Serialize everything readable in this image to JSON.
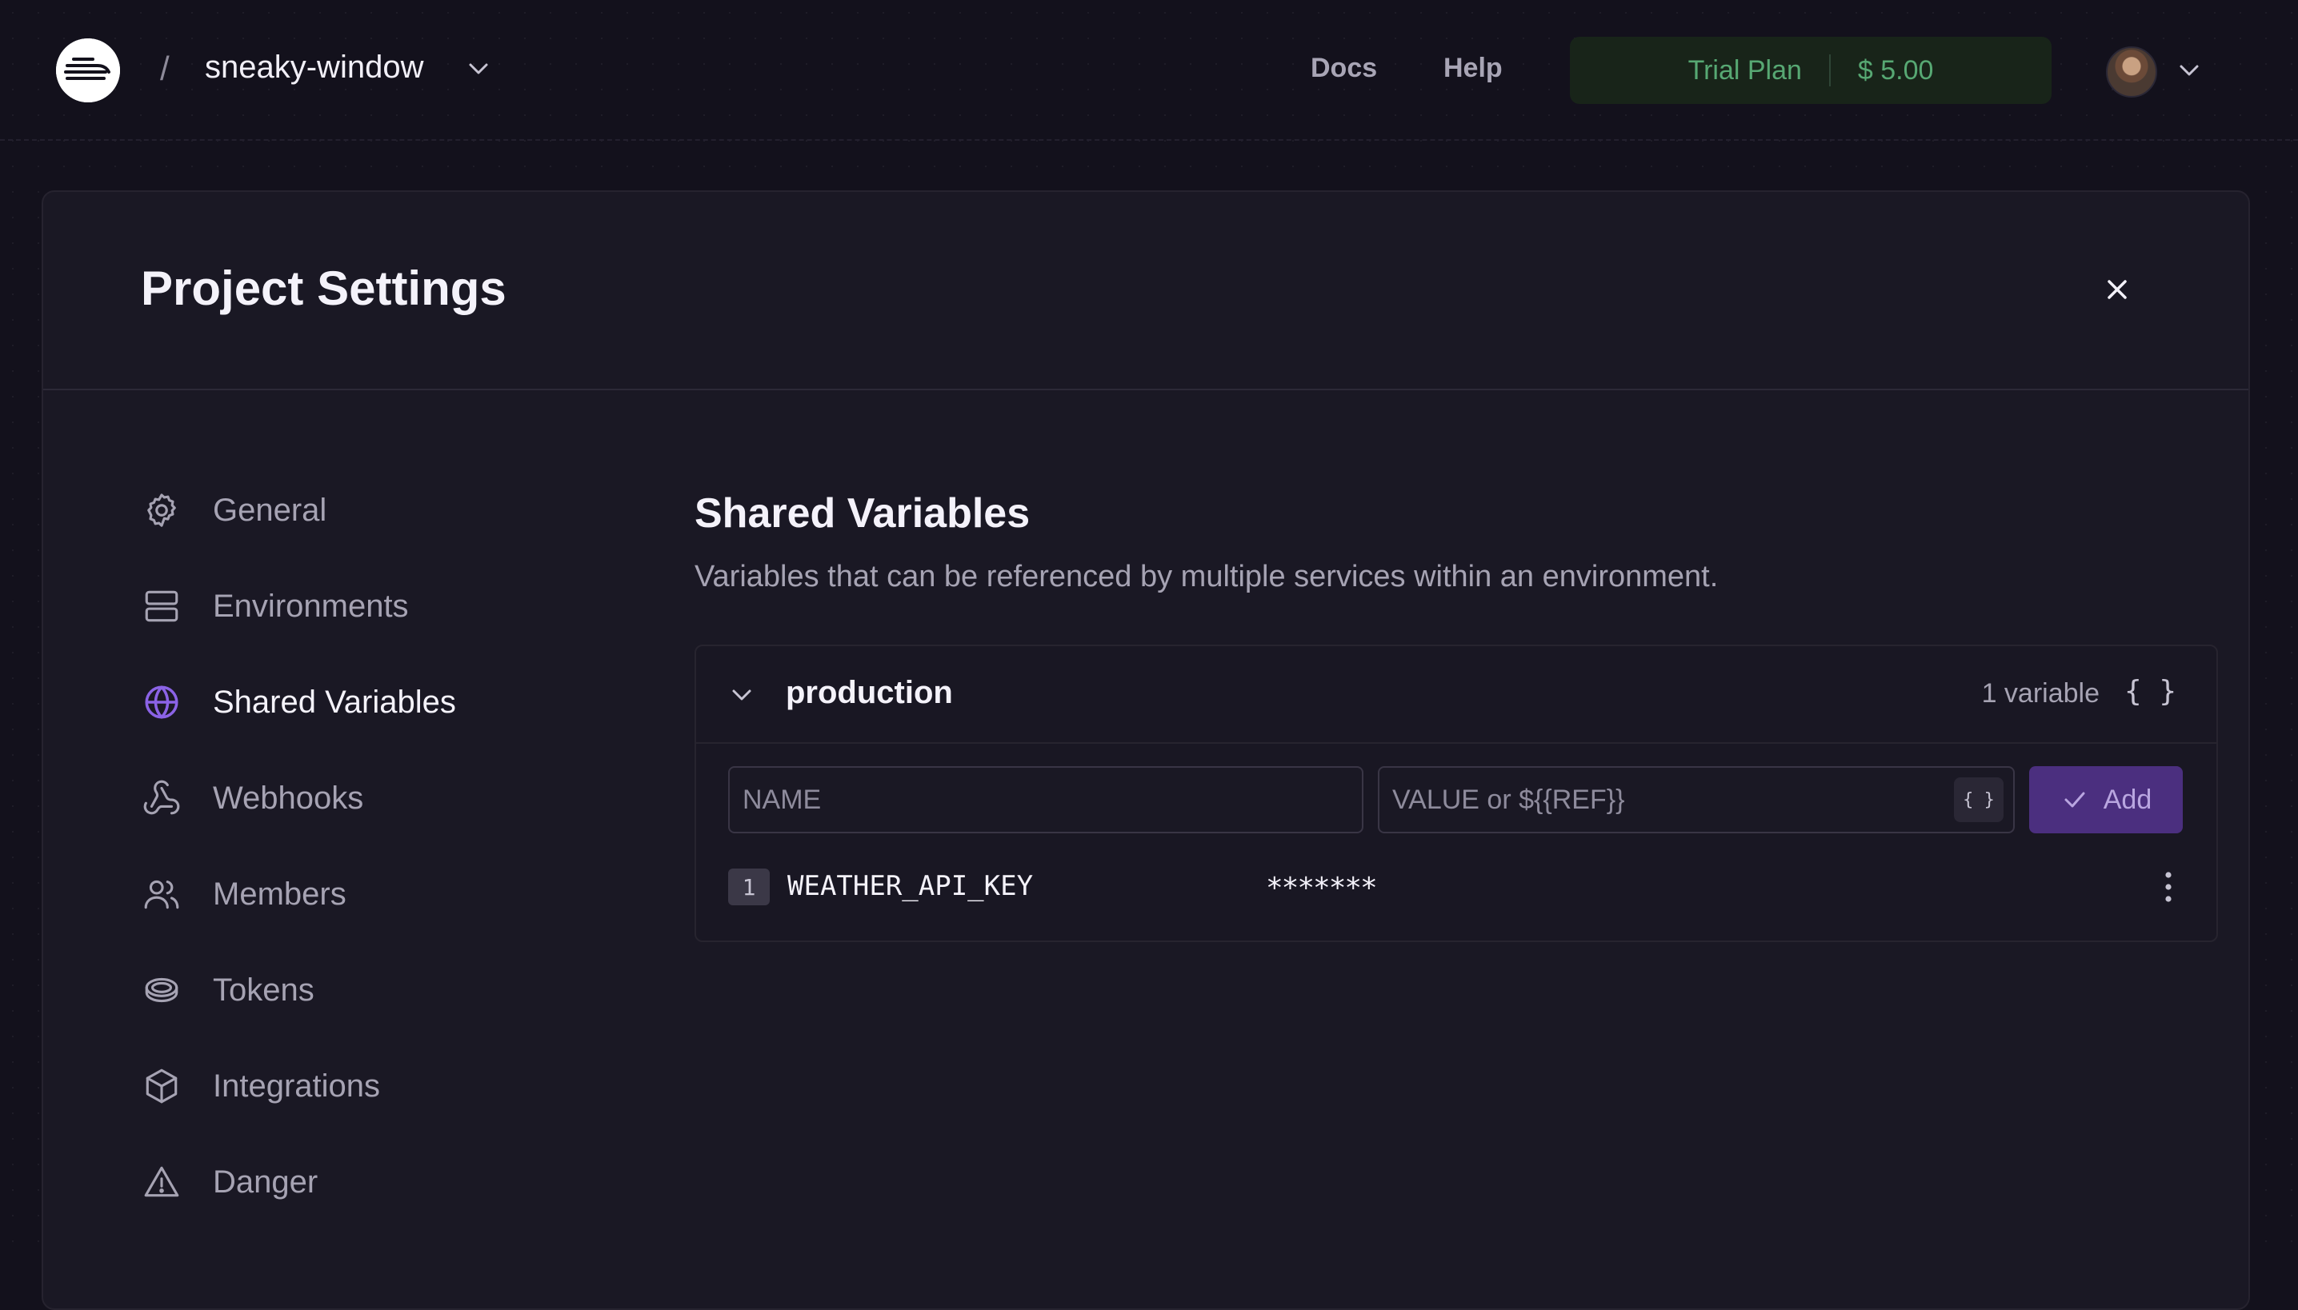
{
  "topbar": {
    "separator": "/",
    "project_name": "sneaky-window",
    "nav": {
      "docs": "Docs",
      "help": "Help"
    },
    "plan": {
      "label": "Trial Plan",
      "amount": "$ 5.00"
    }
  },
  "modal": {
    "title": "Project Settings",
    "close_icon": "close-icon"
  },
  "sidebar": {
    "items": [
      {
        "label": "General",
        "icon": "gear-icon",
        "active": false
      },
      {
        "label": "Environments",
        "icon": "server-icon",
        "active": false
      },
      {
        "label": "Shared Variables",
        "icon": "globe-icon",
        "active": true
      },
      {
        "label": "Webhooks",
        "icon": "webhook-icon",
        "active": false
      },
      {
        "label": "Members",
        "icon": "users-icon",
        "active": false
      },
      {
        "label": "Tokens",
        "icon": "token-icon",
        "active": false
      },
      {
        "label": "Integrations",
        "icon": "cube-icon",
        "active": false
      },
      {
        "label": "Danger",
        "icon": "warning-icon",
        "active": false
      }
    ]
  },
  "content": {
    "title": "Shared Variables",
    "description": "Variables that can be referenced by multiple services within an environment.",
    "environment": {
      "name": "production",
      "count": "1 variable",
      "raw_editor": "{ }",
      "name_placeholder": "NAME",
      "value_placeholder": "VALUE or ${{REF}}",
      "ref_button": "{ }",
      "add_label": "Add",
      "variables": [
        {
          "index": "1",
          "name": "WEATHER_API_KEY",
          "value": "*******"
        }
      ]
    }
  },
  "colors": {
    "accent": "#7c5cd6",
    "plan_green": "#57a873",
    "add_button": "#4b2f7f"
  }
}
